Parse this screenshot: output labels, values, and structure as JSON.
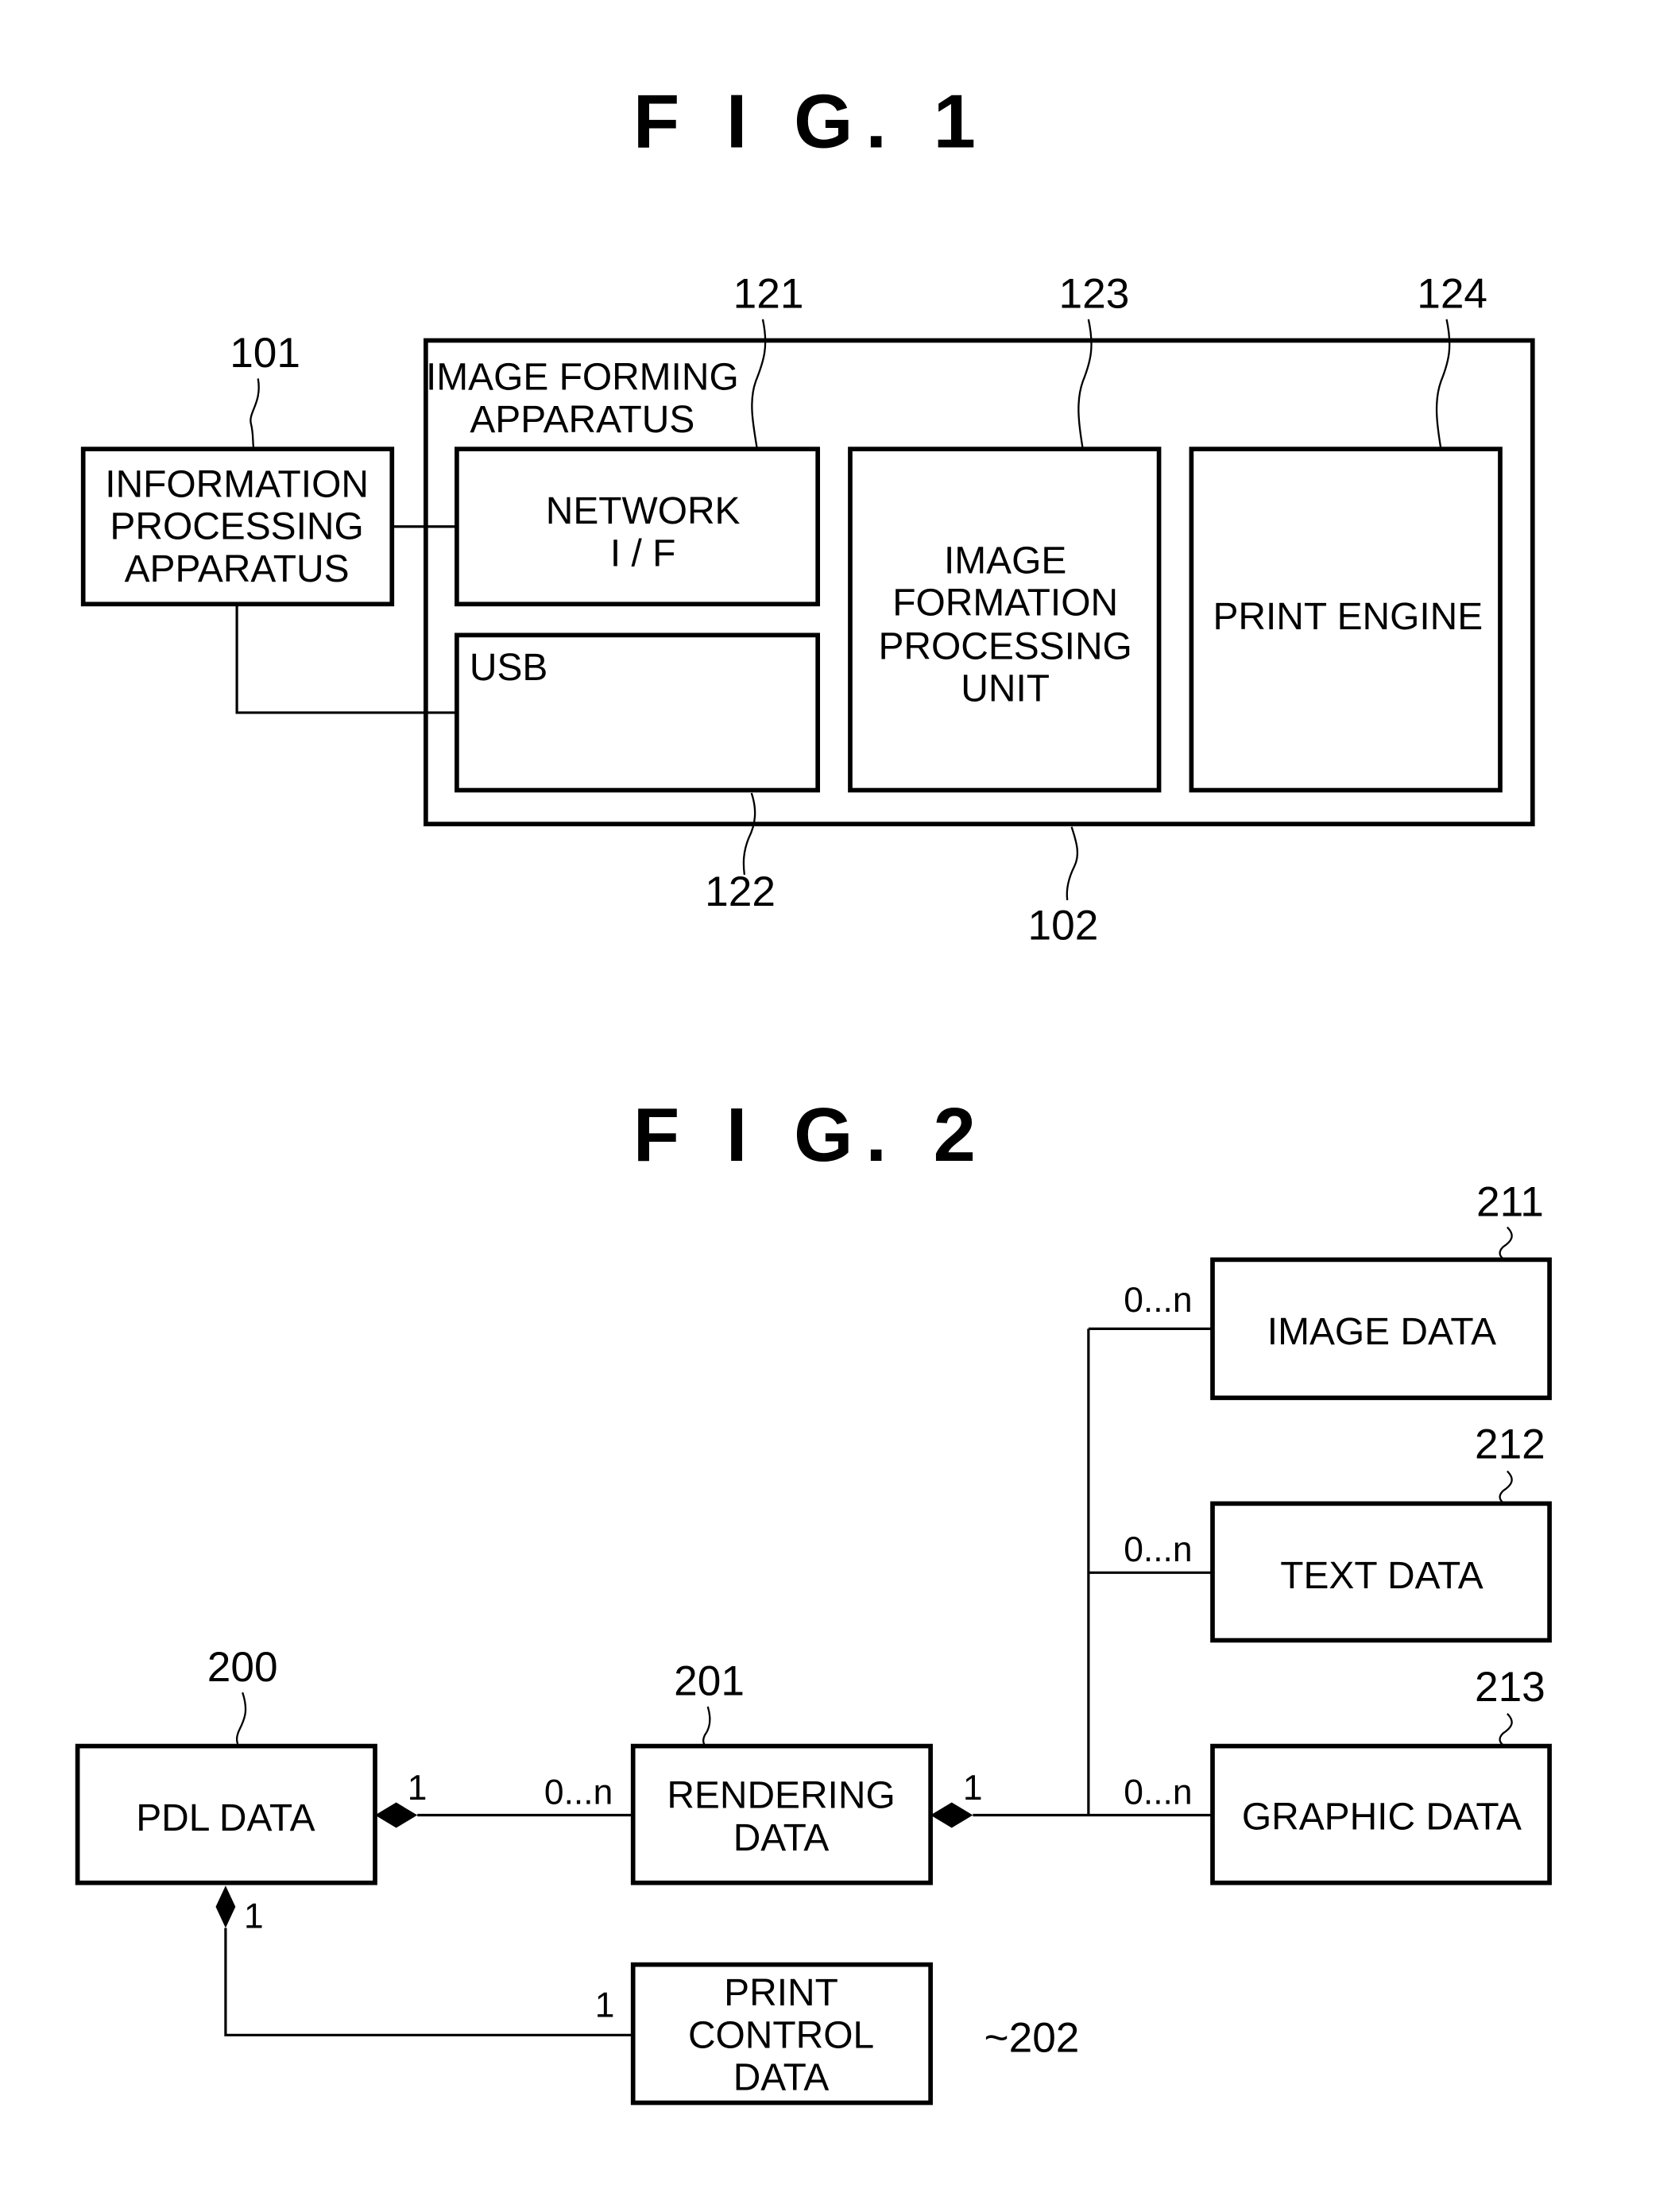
{
  "fig1": {
    "title": "F I G.  1",
    "info_box": {
      "ref": "101",
      "lines": [
        "INFORMATION",
        "PROCESSING",
        "APPARATUS"
      ]
    },
    "apparatus": {
      "ref": "102",
      "lines": [
        "IMAGE FORMING",
        "APPARATUS"
      ]
    },
    "network_if": {
      "ref": "121",
      "lines": [
        "NETWORK",
        "I / F"
      ]
    },
    "usb": {
      "ref": "122",
      "label": "USB"
    },
    "image_formation": {
      "ref": "123",
      "lines": [
        "IMAGE",
        "FORMATION",
        "PROCESSING",
        "UNIT"
      ]
    },
    "print_engine": {
      "ref": "124",
      "label": "PRINT ENGINE"
    }
  },
  "fig2": {
    "title": "F I G.  2",
    "pdl_data": {
      "ref": "200",
      "label": "PDL DATA"
    },
    "rendering_data": {
      "ref": "201",
      "lines": [
        "RENDERING",
        "DATA"
      ]
    },
    "print_control_data": {
      "ref": "~202",
      "lines": [
        "PRINT",
        "CONTROL",
        "DATA"
      ]
    },
    "image_data": {
      "ref": "211",
      "label": "IMAGE DATA"
    },
    "text_data": {
      "ref": "212",
      "label": "TEXT DATA"
    },
    "graphic_data": {
      "ref": "213",
      "label": "GRAPHIC DATA"
    },
    "multiplicities": {
      "pdl_to_rendering_pdl_side": "1",
      "pdl_to_rendering_rendering_side": "0...n",
      "rendering_side_to_children": "1",
      "image_data": "0...n",
      "text_data": "0...n",
      "graphic_data": "0...n",
      "pdl_to_print_control_pdl_side": "1",
      "pdl_to_print_control_control_side": "1"
    }
  }
}
